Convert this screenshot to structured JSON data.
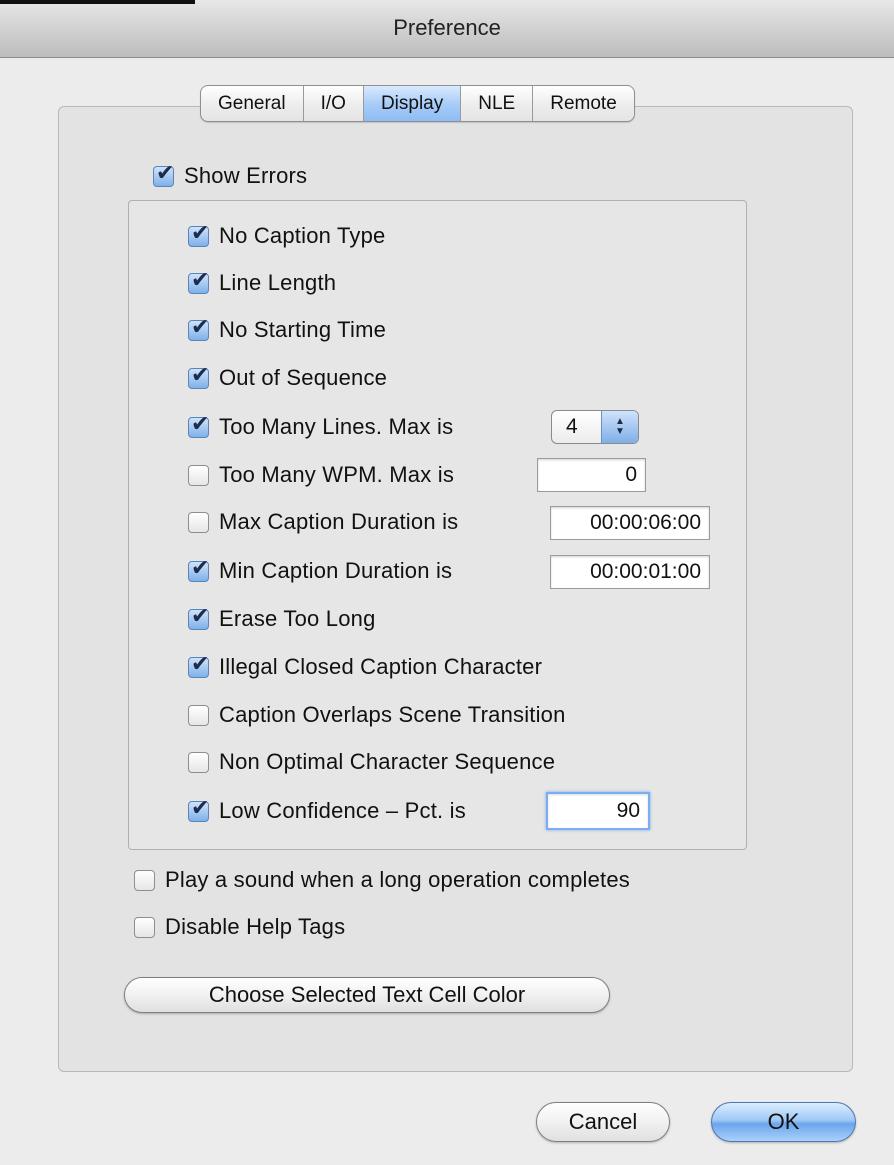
{
  "window": {
    "title": "Preference"
  },
  "tabs": [
    {
      "label": "General",
      "active": false
    },
    {
      "label": "I/O",
      "active": false
    },
    {
      "label": "Display",
      "active": true
    },
    {
      "label": "NLE",
      "active": false
    },
    {
      "label": "Remote",
      "active": false
    }
  ],
  "show_errors": {
    "label": "Show Errors",
    "checked": true
  },
  "errors": {
    "no_caption_type": {
      "label": "No Caption Type",
      "checked": true
    },
    "line_length": {
      "label": "Line Length",
      "checked": true
    },
    "no_starting_time": {
      "label": "No Starting Time",
      "checked": true
    },
    "out_of_sequence": {
      "label": "Out of Sequence",
      "checked": true
    },
    "too_many_lines": {
      "label": "Too Many Lines.  Max is",
      "checked": true,
      "value": "4"
    },
    "too_many_wpm": {
      "label": "Too Many WPM.  Max is",
      "checked": false,
      "value": "0"
    },
    "max_caption_duration": {
      "label": "Max Caption Duration is",
      "checked": false,
      "value": "00:00:06:00"
    },
    "min_caption_duration": {
      "label": "Min Caption Duration is",
      "checked": true,
      "value": "00:00:01:00"
    },
    "erase_too_long": {
      "label": "Erase Too Long",
      "checked": true
    },
    "illegal_cc_char": {
      "label": "Illegal Closed Caption Character",
      "checked": true
    },
    "caption_overlaps": {
      "label": "Caption Overlaps Scene Transition",
      "checked": false
    },
    "non_optimal_seq": {
      "label": "Non Optimal Character Sequence",
      "checked": false
    },
    "low_confidence": {
      "label": "Low Confidence – Pct. is",
      "checked": true,
      "value": "90"
    }
  },
  "play_sound": {
    "label": "Play a sound when a long operation completes",
    "checked": false
  },
  "disable_help_tags": {
    "label": "Disable Help Tags",
    "checked": false
  },
  "buttons": {
    "choose_color": "Choose Selected Text Cell Color",
    "cancel": "Cancel",
    "ok": "OK"
  },
  "colors": {
    "accent": "#8dbcf4",
    "check_fill": "#7fb0ea"
  }
}
